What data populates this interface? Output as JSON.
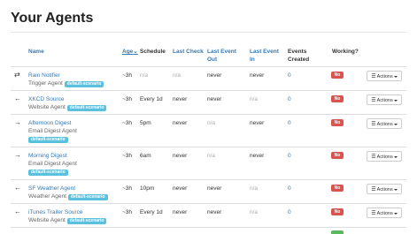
{
  "page": {
    "title": "Your Agents"
  },
  "table": {
    "headers": {
      "name": "Name",
      "age": "Age",
      "schedule": "Schedule",
      "last_check": "Last Check",
      "last_event_out": "Last Event Out",
      "last_event_in": "Last Event In",
      "events_created": "Events Created",
      "working": "Working?"
    },
    "rows": [
      {
        "arrow": "⇄",
        "name": "Rain Notifier",
        "type": "Trigger Agent",
        "age": "~3h",
        "schedule": "n/a",
        "last_check": "n/a",
        "last_event_out": "never",
        "last_event_in": "never",
        "events": "0",
        "working": "No",
        "actions": "Actions"
      },
      {
        "arrow": "←",
        "name": "XKCD Source",
        "type": "Website Agent",
        "age": "~3h",
        "schedule": "Every 1d",
        "last_check": "never",
        "last_event_out": "never",
        "last_event_in": "n/a",
        "events": "0",
        "working": "No",
        "actions": "Actions"
      },
      {
        "arrow": "→",
        "name": "Afternoon Digest",
        "type": "Email Digest Agent",
        "age": "~3h",
        "schedule": "5pm",
        "last_check": "never",
        "last_event_out": "n/a",
        "last_event_in": "never",
        "events": "0",
        "working": "No",
        "actions": "Actions"
      },
      {
        "arrow": "→",
        "name": "Morning Digest",
        "type": "Email Digest Agent",
        "age": "~3h",
        "schedule": "6am",
        "last_check": "never",
        "last_event_out": "n/a",
        "last_event_in": "never",
        "events": "0",
        "working": "No",
        "actions": "Actions"
      },
      {
        "arrow": "←",
        "name": "SF Weather Agent",
        "type": "Weather Agent",
        "age": "~3h",
        "schedule": "10pm",
        "last_check": "never",
        "last_event_out": "never",
        "last_event_in": "n/a",
        "events": "0",
        "working": "No",
        "actions": "Actions"
      },
      {
        "arrow": "←",
        "name": "iTunes Trailer Source",
        "type": "Website Agent",
        "age": "~3h",
        "schedule": "Every 1d",
        "last_check": "never",
        "last_event_out": "never",
        "last_event_in": "n/a",
        "events": "0",
        "working": "No",
        "actions": "Actions"
      }
    ],
    "badge": "default-scenario"
  },
  "colors": {
    "link": "#337ab7",
    "badge": "#5bc0de",
    "no": "#d9534f",
    "yes": "#5cb85c"
  }
}
